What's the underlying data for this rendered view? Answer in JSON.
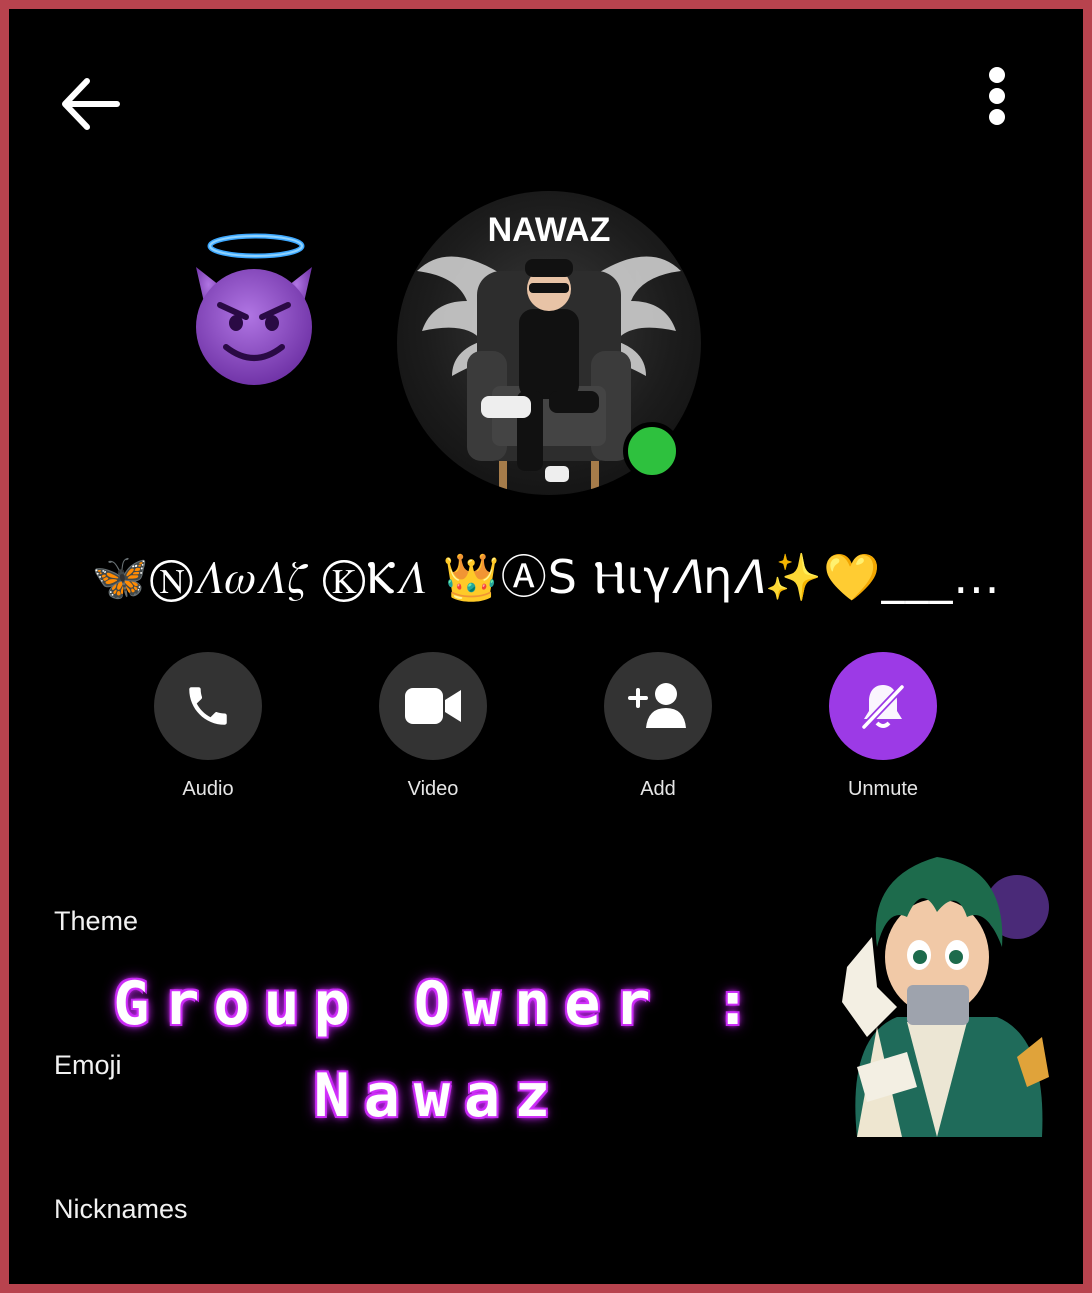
{
  "header": {
    "back_icon": "arrow-left-icon",
    "menu_icon": "more-vertical-icon"
  },
  "profile": {
    "avatar_title": "NAWAZ",
    "name": "🦋Ⓝ𝛬𝜔𝛬𝜁 ⓀⲔ𝛬 👑ⒶS Ⲏιγ𝛬η𝛬✨💛___...",
    "online": true,
    "online_color": "#2ec13e"
  },
  "actions": [
    {
      "label": "Audio",
      "icon": "phone-icon"
    },
    {
      "label": "Video",
      "icon": "video-camera-icon"
    },
    {
      "label": "Add",
      "icon": "add-person-icon"
    },
    {
      "label": "Unmute",
      "icon": "bell-off-icon",
      "accent": "#9c3ae6"
    }
  ],
  "settings": {
    "theme": "Theme",
    "emoji": "Emoji",
    "nicknames": "Nicknames"
  },
  "overlay_text": {
    "line1": "Group Owner :",
    "line2": "Nawaz"
  },
  "colors": {
    "frame": "#b8434e",
    "background": "#000000",
    "action_bg": "#333333",
    "glow": "#d02cff"
  }
}
